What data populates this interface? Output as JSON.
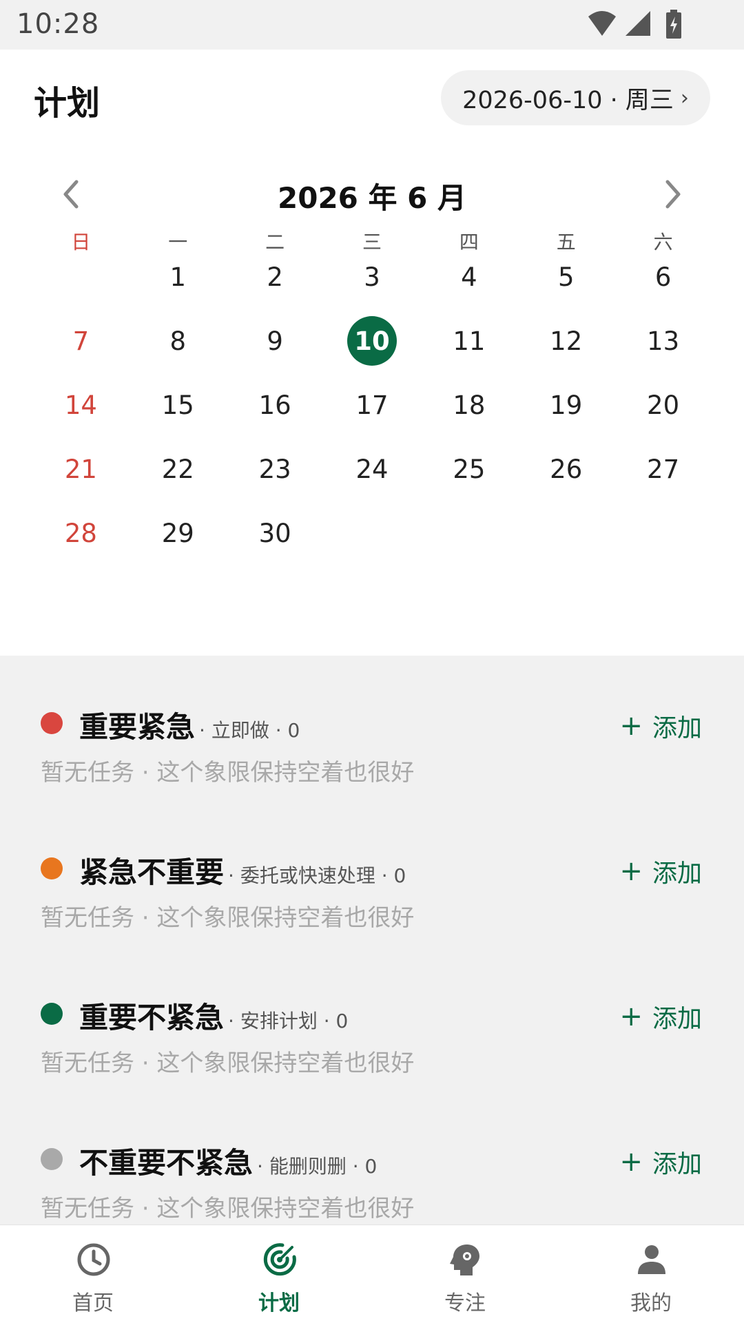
{
  "status_bar": {
    "time": "10:28"
  },
  "header": {
    "title": "计划",
    "date_chip": {
      "label": "2026-06-10 · 周三",
      "chevron": "›"
    }
  },
  "calendar": {
    "month_title": "2026 年 6 月",
    "weekdays": [
      "日",
      "一",
      "二",
      "三",
      "四",
      "五",
      "六"
    ],
    "weeks": [
      [
        "",
        "1",
        "2",
        "3",
        "4",
        "5",
        "6"
      ],
      [
        "7",
        "8",
        "9",
        "10",
        "11",
        "12",
        "13"
      ],
      [
        "14",
        "15",
        "16",
        "17",
        "18",
        "19",
        "20"
      ],
      [
        "21",
        "22",
        "23",
        "24",
        "25",
        "26",
        "27"
      ],
      [
        "28",
        "29",
        "30",
        "",
        "",
        "",
        ""
      ]
    ],
    "selected_day": "10",
    "colors": {
      "selected": "#0a6b45",
      "weekend": "#d1453b"
    }
  },
  "quadrants": [
    {
      "title": "重要紧急",
      "subtitle": "· 立即做 · 0",
      "color": "#d9463f",
      "add_label": "添加",
      "empty_text": "暂无任务 · 这个象限保持空着也很好"
    },
    {
      "title": "紧急不重要",
      "subtitle": "· 委托或快速处理 · 0",
      "color": "#e8761f",
      "add_label": "添加",
      "empty_text": "暂无任务 · 这个象限保持空着也很好"
    },
    {
      "title": "重要不紧急",
      "subtitle": "· 安排计划 · 0",
      "color": "#0a6b45",
      "add_label": "添加",
      "empty_text": "暂无任务 · 这个象限保持空着也很好"
    },
    {
      "title": "不重要不紧急",
      "subtitle": "· 能删则删 · 0",
      "color": "#a9a9a9",
      "add_label": "添加",
      "empty_text": "暂无任务 · 这个象限保持空着也很好"
    }
  ],
  "bottom_nav": [
    {
      "label": "首页",
      "icon": "clock-icon",
      "active": false
    },
    {
      "label": "计划",
      "icon": "target-icon",
      "active": true
    },
    {
      "label": "专注",
      "icon": "brain-head-icon",
      "active": false
    },
    {
      "label": "我的",
      "icon": "person-icon",
      "active": false
    }
  ]
}
